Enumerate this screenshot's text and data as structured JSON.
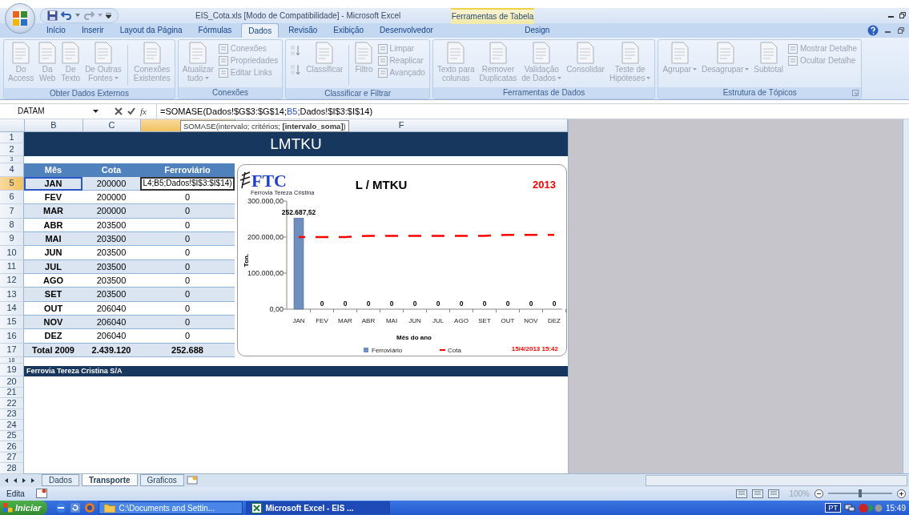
{
  "window": {
    "title": "EIS_Cota.xls  [Modo de Compatibilidade] - Microsoft Excel",
    "context_group": "Ferramentas de Tabela"
  },
  "ribbon": {
    "disabled": true,
    "tabs": [
      {
        "label": "Início",
        "selected": false
      },
      {
        "label": "Inserir",
        "selected": false
      },
      {
        "label": "Layout da Página",
        "selected": false
      },
      {
        "label": "Fórmulas",
        "selected": false
      },
      {
        "label": "Dados",
        "selected": true
      },
      {
        "label": "Revisão",
        "selected": false
      },
      {
        "label": "Exibição",
        "selected": false
      },
      {
        "label": "Desenvolvedor",
        "selected": false
      }
    ],
    "context_tabs": [
      {
        "label": "Design",
        "selected": false
      }
    ],
    "groups": [
      {
        "label": "Obter Dados Externos",
        "items": [
          {
            "kind": "large",
            "label": "Do\nAccess"
          },
          {
            "kind": "large",
            "label": "Da\nWeb"
          },
          {
            "kind": "large",
            "label": "De\nTexto"
          },
          {
            "kind": "large",
            "label": "De Outras\nFontes",
            "dropdown": true
          },
          {
            "kind": "separator"
          },
          {
            "kind": "large",
            "label": "Conexões\nExistentes"
          }
        ]
      },
      {
        "label": "Conexões",
        "items": [
          {
            "kind": "large",
            "label": "Atualizar\ntudo",
            "dropdown": true
          },
          {
            "kind": "stack",
            "items": [
              {
                "label": "Conexões"
              },
              {
                "label": "Propriedades"
              },
              {
                "label": "Editar Links"
              }
            ]
          }
        ]
      },
      {
        "label": "Classificar e Filtrar",
        "items": [
          {
            "kind": "sort"
          },
          {
            "kind": "large",
            "label": "Classificar"
          },
          {
            "kind": "separator"
          },
          {
            "kind": "large",
            "label": "Filtro"
          },
          {
            "kind": "stack",
            "items": [
              {
                "label": "Limpar"
              },
              {
                "label": "Reaplicar"
              },
              {
                "label": "Avançado"
              }
            ]
          }
        ]
      },
      {
        "label": "Ferramentas de Dados",
        "items": [
          {
            "kind": "large",
            "label": "Texto para\ncolunas"
          },
          {
            "kind": "large",
            "label": "Remover\nDuplicatas"
          },
          {
            "kind": "large",
            "label": "Validação\nde Dados",
            "dropdown": true
          },
          {
            "kind": "large",
            "label": "Consolidar"
          },
          {
            "kind": "large",
            "label": "Teste de\nHipóteses",
            "dropdown": true
          }
        ]
      },
      {
        "label": "Estrutura de Tópicos",
        "launcher": true,
        "items": [
          {
            "kind": "large",
            "label": "Agrupar",
            "dropdown": true
          },
          {
            "kind": "large",
            "label": "Desagrupar",
            "dropdown": true
          },
          {
            "kind": "large",
            "label": "Subtotal"
          },
          {
            "kind": "stack",
            "items": [
              {
                "label": "Mostrar Detalhe"
              },
              {
                "label": "Ocultar Detalhe"
              }
            ]
          }
        ]
      }
    ]
  },
  "formula_bar": {
    "name_box": "DATAM",
    "function_label": "fx",
    "formula_before": "=SOMASE(Dados!$G$3:$G$14;",
    "formula_ref": "B5",
    "formula_after": ";Dados!$I$3:$I$14)",
    "tooltip": "SOMASE(intervalo; critérios; **[intervalo_soma]**)"
  },
  "sheet": {
    "column_headers": [
      {
        "label": "B",
        "selected": false
      },
      {
        "label": "C",
        "selected": false
      },
      {
        "selected": true
      },
      {
        "label": "F",
        "selected": false
      }
    ],
    "row_numbers": [
      "1",
      "2",
      "3",
      "4",
      "5",
      "6",
      "7",
      "8",
      "9",
      "10",
      "11",
      "12",
      "13",
      "14",
      "15",
      "16",
      "17",
      "18",
      "19",
      "20",
      "21",
      "22",
      "23",
      "24",
      "25",
      "26",
      "27",
      "28"
    ],
    "title": "LMTKU",
    "table": {
      "columns": [
        "Mês",
        "Cota",
        "Ferroviário"
      ],
      "rows": [
        {
          "month": "JAN",
          "quota": "200000",
          "rail": "L4;B5;Dados!$I$3:$I$14)",
          "selected": true,
          "editing": true
        },
        {
          "month": "FEV",
          "quota": "200000",
          "rail": "0",
          "selected": false,
          "editing": false
        },
        {
          "month": "MAR",
          "quota": "200000",
          "rail": "0",
          "selected": false,
          "editing": false
        },
        {
          "month": "ABR",
          "quota": "203500",
          "rail": "0",
          "selected": false,
          "editing": false
        },
        {
          "month": "MAI",
          "quota": "203500",
          "rail": "0",
          "selected": false,
          "editing": false
        },
        {
          "month": "JUN",
          "quota": "203500",
          "rail": "0",
          "selected": false,
          "editing": false
        },
        {
          "month": "JUL",
          "quota": "203500",
          "rail": "0",
          "selected": false,
          "editing": false
        },
        {
          "month": "AGO",
          "quota": "203500",
          "rail": "0",
          "selected": false,
          "editing": false
        },
        {
          "month": "SET",
          "quota": "203500",
          "rail": "0",
          "selected": false,
          "editing": false
        },
        {
          "month": "OUT",
          "quota": "206040",
          "rail": "0",
          "selected": false,
          "editing": false
        },
        {
          "month": "NOV",
          "quota": "206040",
          "rail": "0",
          "selected": false,
          "editing": false
        },
        {
          "month": "DEZ",
          "quota": "206040",
          "rail": "0",
          "selected": false,
          "editing": false
        }
      ],
      "total": {
        "label": "Total 2009",
        "quota": "2.439.120",
        "rail": "252.688"
      }
    },
    "footer_band": "Ferrovia Tereza Cristina S/A",
    "chart": {
      "logo": "FTC",
      "logo_subtitle": "Ferrovia Tereza Cristina",
      "year": "2013",
      "timestamp": "15/4/2013 15:42",
      "chart_data": {
        "type": "bar",
        "title": "L / MTKU",
        "xlabel": "Mês do ano",
        "ylabel": "Ton.",
        "categories": [
          "JAN",
          "FEV",
          "MAR",
          "ABR",
          "MAI",
          "JUN",
          "JUL",
          "AGO",
          "SET",
          "OUT",
          "NOV",
          "DEZ"
        ],
        "series": [
          {
            "name": "Ferroviário",
            "type": "bar",
            "color": "#6f8fbf",
            "values": [
              252687.52,
              0,
              0,
              0,
              0,
              0,
              0,
              0,
              0,
              0,
              0,
              0
            ]
          },
          {
            "name": "Cota",
            "type": "line",
            "line_style": "dashed",
            "color": "#ff0000",
            "values": [
              200000,
              200000,
              200000,
              203500,
              203500,
              203500,
              203500,
              203500,
              203500,
              206040,
              206040,
              206040
            ]
          }
        ],
        "ylim": [
          0,
          300000
        ],
        "yticks": [
          {
            "value": 0,
            "label": "0,00"
          },
          {
            "value": 100000,
            "label": "100.000,00"
          },
          {
            "value": 200000,
            "label": "200.000,00"
          },
          {
            "value": 300000,
            "label": "300.000,00"
          }
        ],
        "value_labels": [
          [
            "252.687,52",
            "0",
            "0",
            "0",
            "0",
            "0",
            "0",
            "0",
            "0",
            "0",
            "0",
            "0"
          ],
          [
            null,
            null,
            null,
            null,
            null,
            null,
            null,
            null,
            null,
            null,
            null,
            null
          ]
        ],
        "legend": true
      }
    }
  },
  "sheet_tabs": [
    {
      "label": "Dados",
      "selected": false
    },
    {
      "label": "Transporte",
      "selected": true
    },
    {
      "label": "Graficos",
      "selected": false
    }
  ],
  "status_bar": {
    "mode": "Edita",
    "zoom": "100%",
    "zoom_slider": {
      "level": 0.5
    }
  },
  "taskbar": {
    "start": "Iniciar",
    "tasks": [
      {
        "label": "C:\\Documents and Settin...",
        "selected": false,
        "kind": "folder"
      },
      {
        "label": "Microsoft Excel - EIS  ...",
        "selected": true,
        "kind": "excel"
      }
    ],
    "language": "PT",
    "clock": "15:49"
  }
}
